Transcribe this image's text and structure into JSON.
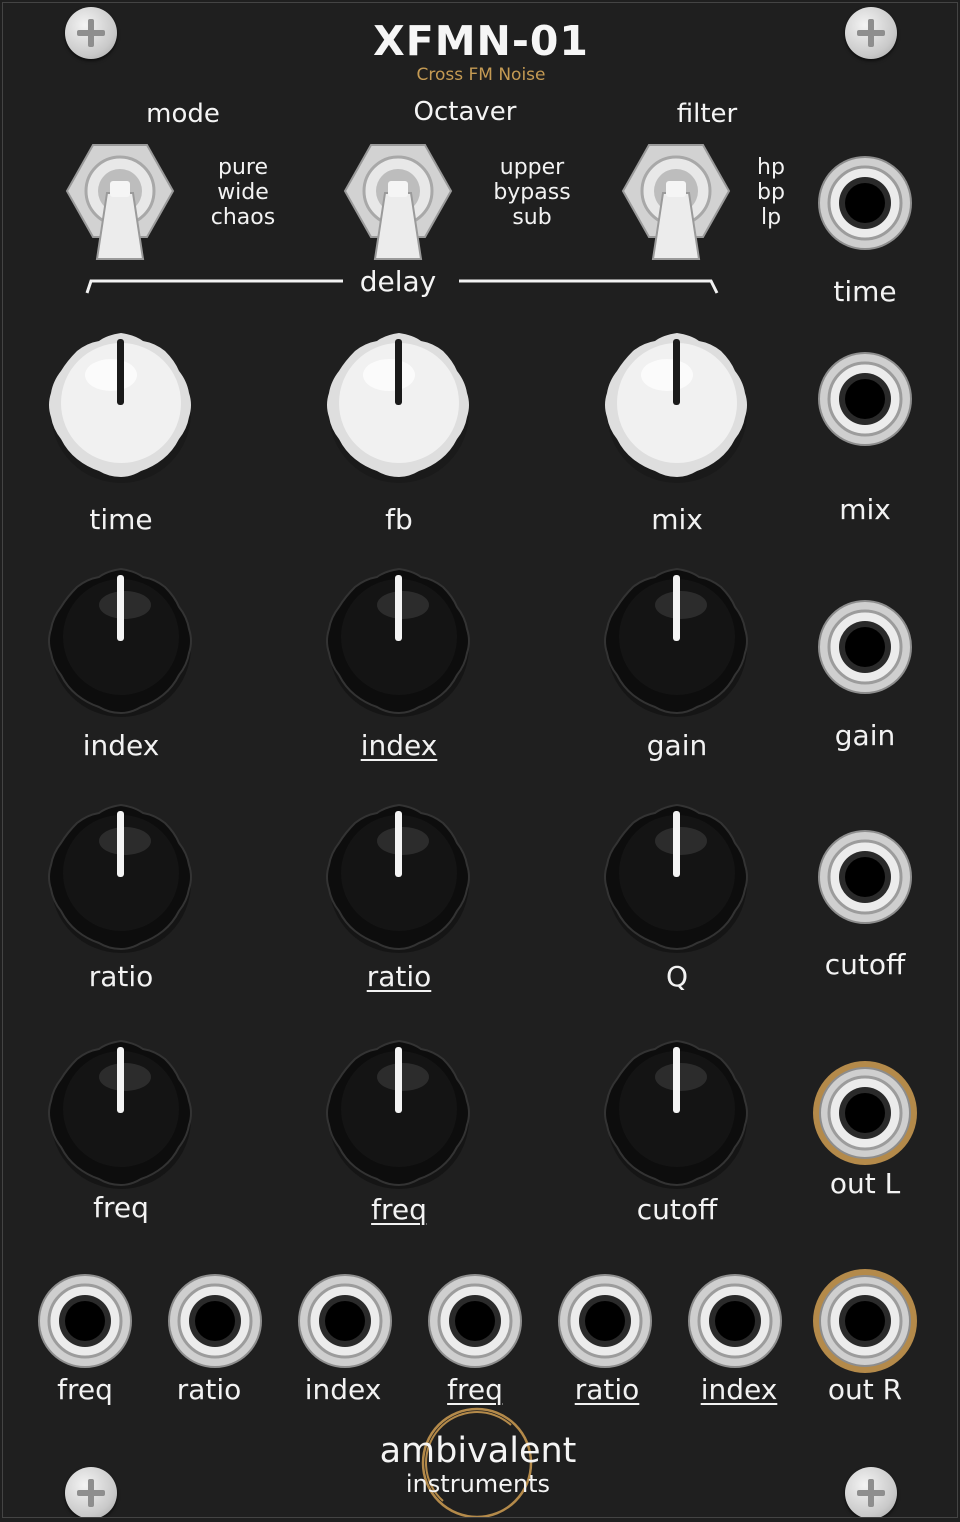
{
  "module": {
    "title": "XFMN-01",
    "subtitle": "Cross FM Noise"
  },
  "switches": [
    {
      "name": "mode",
      "options": [
        "pure",
        "wide",
        "chaos"
      ]
    },
    {
      "name": "Octaver",
      "options": [
        "upper",
        "bypass",
        "sub"
      ]
    },
    {
      "name": "filter",
      "options": [
        "hp",
        "bp",
        "lp"
      ]
    }
  ],
  "delay_label": "delay",
  "knobs": {
    "white": [
      {
        "label": "time"
      },
      {
        "label": "fb"
      },
      {
        "label": "mix"
      }
    ],
    "row2": [
      {
        "label": "index"
      },
      {
        "label": "index"
      },
      {
        "label": "gain"
      }
    ],
    "row3": [
      {
        "label": "ratio"
      },
      {
        "label": "ratio"
      },
      {
        "label": "Q"
      }
    ],
    "row4": [
      {
        "label": "freq"
      },
      {
        "label": "freq"
      },
      {
        "label": "cutoff"
      }
    ]
  },
  "side_jacks": [
    {
      "label": "time"
    },
    {
      "label": "mix"
    },
    {
      "label": "gain"
    },
    {
      "label": "cutoff"
    },
    {
      "label": "out L"
    }
  ],
  "bottom_jacks": [
    {
      "label": "freq"
    },
    {
      "label": "ratio"
    },
    {
      "label": "index"
    },
    {
      "label": "freq"
    },
    {
      "label": "ratio"
    },
    {
      "label": "index"
    },
    {
      "label": "out R"
    }
  ],
  "brand": {
    "line1": "ambivalent",
    "line2": "instruments"
  },
  "colors": {
    "panel": "#1f1f1f",
    "accent": "#c49a53",
    "text": "#f4f4f4"
  }
}
